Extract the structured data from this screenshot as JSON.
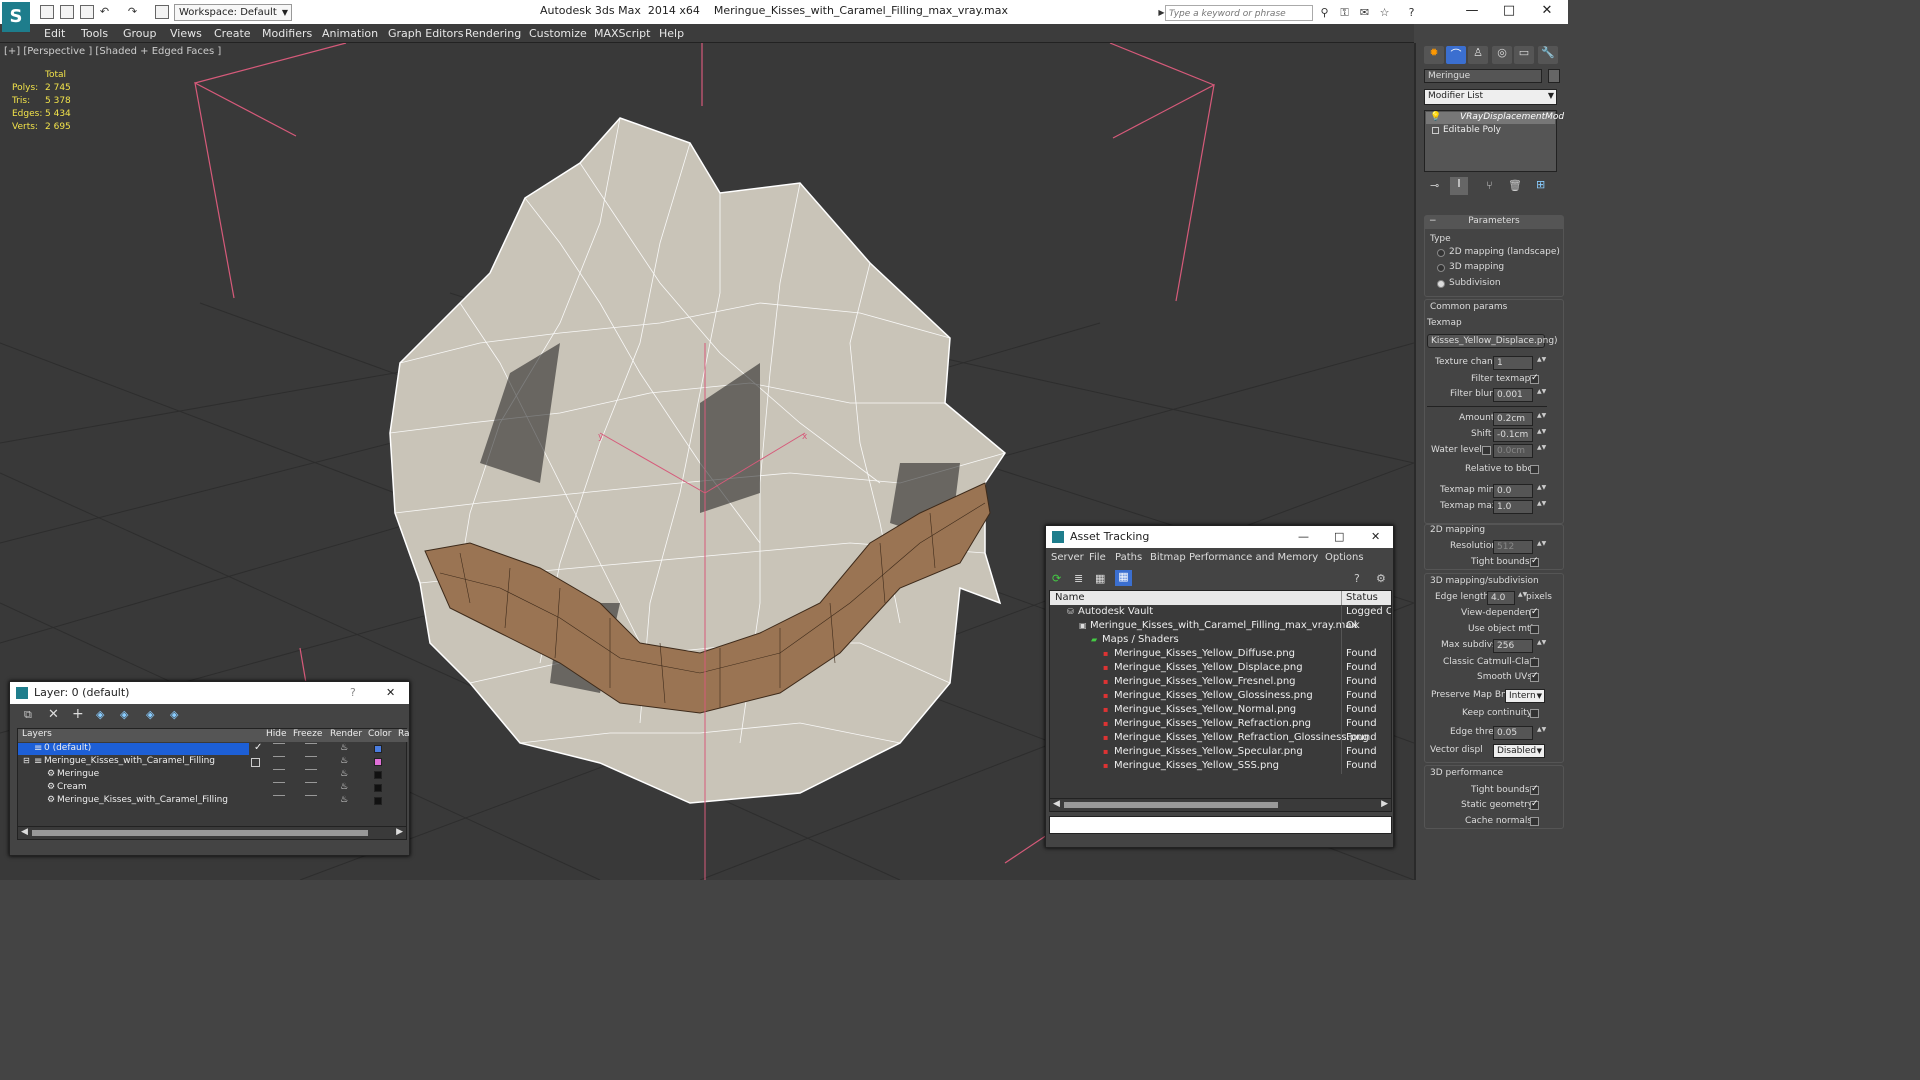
{
  "titlebar": {
    "app": "Autodesk 3ds Max  2014 x64",
    "file": "Meringue_Kisses_with_Caramel_Filling_max_vray.max",
    "workspace": "Workspace: Default",
    "search_placeholder": "Type a keyword or phrase",
    "win_min": "—",
    "win_max": "□",
    "win_close": "✕"
  },
  "menu": [
    "Edit",
    "Tools",
    "Group",
    "Views",
    "Create",
    "Modifiers",
    "Animation",
    "Graph Editors",
    "Rendering",
    "Customize",
    "MAXScript",
    "Help"
  ],
  "viewport": {
    "label": "[+] [Perspective ] [Shaded + Edged Faces ]",
    "stats_header": "Total",
    "stats": [
      {
        "label": "Polys:",
        "value": "2 745"
      },
      {
        "label": "Tris:",
        "value": "5 378"
      },
      {
        "label": "Edges:",
        "value": "5 434"
      },
      {
        "label": "Verts:",
        "value": "2 695"
      }
    ],
    "axis_x": "x",
    "axis_y": "y",
    "colors": {
      "background": "#393939",
      "grid": "#2e2e2e",
      "bbox": "#d65a7a",
      "mesh": "#c9c4b8",
      "caramel": "#9a7453"
    }
  },
  "command_panel": {
    "object_name": "Meringue",
    "modifier_list": "Modifier List",
    "stack": [
      "VRayDisplacementMod",
      "Editable Poly"
    ],
    "parameters_title": "Parameters",
    "type_label": "Type",
    "type_options": [
      "2D mapping (landscape)",
      "3D mapping",
      "Subdivision"
    ],
    "type_selected": 2,
    "common_params": "Common params",
    "texmap_label": "Texmap",
    "texmap_value": "Kisses_Yellow_Displace.png)",
    "texture_chan_label": "Texture chan",
    "texture_chan_value": "1",
    "filter_texmap": "Filter texmap",
    "filter_blur_label": "Filter blur",
    "filter_blur_value": "0.001",
    "amount_label": "Amount",
    "amount_value": "0.2cm",
    "shift_label": "Shift",
    "shift_value": "-0.1cm",
    "water_label": "Water level",
    "water_value": "0.0cm",
    "relative_bbox": "Relative to bbox",
    "texmap_min_label": "Texmap min",
    "texmap_min_value": "0.0",
    "texmap_max_label": "Texmap max",
    "texmap_max_value": "1.0",
    "mapping2d": "2D mapping",
    "resolution_label": "Resolution",
    "resolution_value": "512",
    "tight_bounds": "Tight bounds",
    "mapping3d": "3D mapping/subdivision",
    "edge_length_label": "Edge length",
    "edge_length_value": "4.0",
    "pixels": "pixels",
    "view_dependent": "View-dependent",
    "use_object_mtl": "Use object mtl",
    "max_subdivs_label": "Max subdivs",
    "max_subdivs_value": "256",
    "classic_catmull": "Classic Catmull-Clark",
    "smooth_uvs": "Smooth UVs",
    "preserve_map_label": "Preserve Map Bnd",
    "preserve_map_value": "Intern",
    "keep_continuity": "Keep continuity",
    "edge_thresh_label": "Edge thresh",
    "edge_thresh_value": "0.05",
    "vector_displ_label": "Vector displ",
    "vector_displ_value": "Disabled",
    "perf_title": "3D performance",
    "perf_tight": "Tight bounds",
    "perf_static": "Static geometry",
    "perf_cache": "Cache normals"
  },
  "layer_window": {
    "title": "Layer: 0 (default)",
    "help": "?",
    "close": "✕",
    "columns": [
      "Layers",
      "Hide",
      "Freeze",
      "Render",
      "Color",
      "Ra"
    ],
    "rows": [
      {
        "name": "0 (default)",
        "indent": 0,
        "color": "#4a7de0"
      },
      {
        "name": "Meringue_Kisses_with_Caramel_Filling",
        "indent": 0,
        "color": "#e070d8"
      },
      {
        "name": "Meringue",
        "indent": 1,
        "color": "#111111"
      },
      {
        "name": "Cream",
        "indent": 1,
        "color": "#111111"
      },
      {
        "name": "Meringue_Kisses_with_Caramel_Filling",
        "indent": 1,
        "color": "#111111"
      }
    ]
  },
  "asset_window": {
    "title": "Asset Tracking",
    "menu": [
      "Server",
      "File",
      "Paths",
      "Bitmap Performance and Memory",
      "Options"
    ],
    "col_name": "Name",
    "col_status": "Status",
    "rows": [
      {
        "name": "Autodesk Vault",
        "status": "Logged Ou",
        "indent": 1
      },
      {
        "name": "Meringue_Kisses_with_Caramel_Filling_max_vray.max",
        "status": "Ok",
        "indent": 2
      },
      {
        "name": "Maps / Shaders",
        "status": "",
        "indent": 3
      },
      {
        "name": "Meringue_Kisses_Yellow_Diffuse.png",
        "status": "Found",
        "indent": 4
      },
      {
        "name": "Meringue_Kisses_Yellow_Displace.png",
        "status": "Found",
        "indent": 4
      },
      {
        "name": "Meringue_Kisses_Yellow_Fresnel.png",
        "status": "Found",
        "indent": 4
      },
      {
        "name": "Meringue_Kisses_Yellow_Glossiness.png",
        "status": "Found",
        "indent": 4
      },
      {
        "name": "Meringue_Kisses_Yellow_Normal.png",
        "status": "Found",
        "indent": 4
      },
      {
        "name": "Meringue_Kisses_Yellow_Refraction.png",
        "status": "Found",
        "indent": 4
      },
      {
        "name": "Meringue_Kisses_Yellow_Refraction_Glossiness.png",
        "status": "Found",
        "indent": 4
      },
      {
        "name": "Meringue_Kisses_Yellow_Specular.png",
        "status": "Found",
        "indent": 4
      },
      {
        "name": "Meringue_Kisses_Yellow_SSS.png",
        "status": "Found",
        "indent": 4
      }
    ]
  }
}
